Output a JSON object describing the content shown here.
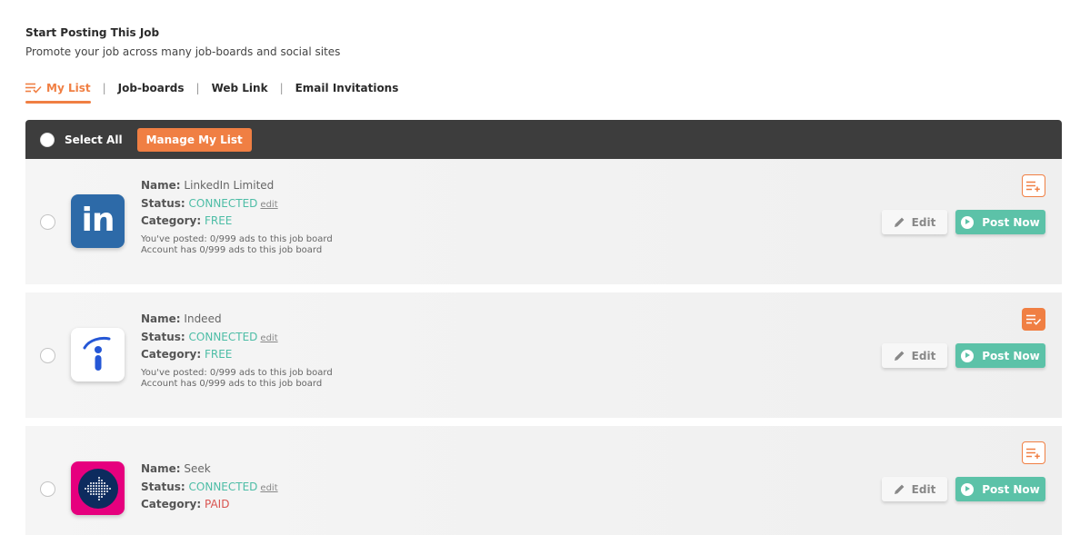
{
  "header": {
    "title": "Start Posting This Job",
    "subtitle": "Promote your job across many job-boards and social sites"
  },
  "tabs": [
    {
      "label": "My List",
      "active": true
    },
    {
      "label": "Job-boards",
      "active": false
    },
    {
      "label": "Web Link",
      "active": false
    },
    {
      "label": "Email Invitations",
      "active": false
    }
  ],
  "tab_separator": "|",
  "toolbar": {
    "select_all_label": "Select All",
    "manage_label": "Manage My List"
  },
  "labels": {
    "name": "Name:",
    "status": "Status:",
    "category": "Category:",
    "edit_link": "edit",
    "edit_button": "Edit",
    "post_button": "Post Now"
  },
  "boards": [
    {
      "name": "LinkedIn Limited",
      "status": "CONNECTED",
      "category": "FREE",
      "posted": "You've posted: 0/999 ads to this job board",
      "account": "Account has 0/999 ads to this job board",
      "logo": "linkedin-logo",
      "logo_text": "in",
      "in_list": false
    },
    {
      "name": "Indeed",
      "status": "CONNECTED",
      "category": "FREE",
      "posted": "You've posted: 0/999 ads to this job board",
      "account": "Account has 0/999 ads to this job board",
      "logo": "indeed-logo",
      "in_list": true
    },
    {
      "name": "Seek",
      "status": "CONNECTED",
      "category": "PAID",
      "logo": "seek-logo",
      "in_list": false
    }
  ],
  "colors": {
    "accent": "#f07f43",
    "connected": "#4dbda6",
    "paid": "#d9534f",
    "post_button": "#5cc2a8",
    "toolbar": "#3d3d3d",
    "linkedin": "#2d6aa8",
    "seek_pink": "#e6007e",
    "seek_navy": "#0d2b5e"
  }
}
